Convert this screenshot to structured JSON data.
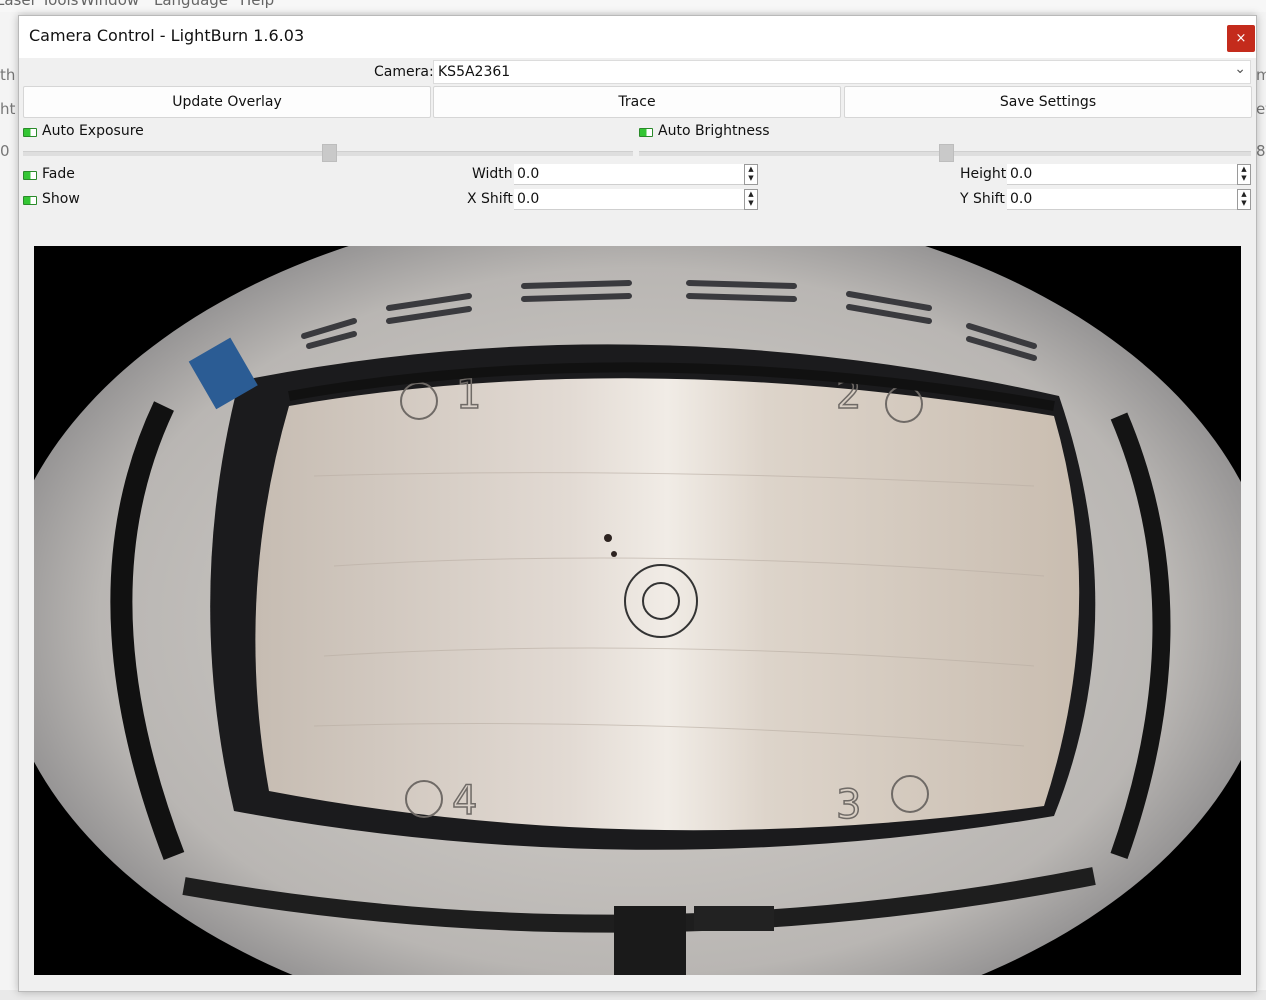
{
  "background": {
    "menu_items": [
      "Laser Tools",
      "Window",
      "Language",
      "Help"
    ],
    "edge_left": [
      "th",
      "ht",
      "0"
    ],
    "edge_right": [
      "m",
      "et",
      "8"
    ]
  },
  "dialog": {
    "title": "Camera Control - LightBurn 1.6.03",
    "close_glyph": "×"
  },
  "camera": {
    "label": "Camera:",
    "value": "KS5A2361"
  },
  "buttons": {
    "update_overlay": "Update Overlay",
    "trace": "Trace",
    "save_settings": "Save Settings"
  },
  "toggles": {
    "auto_exposure": "Auto Exposure",
    "auto_brightness": "Auto Brightness",
    "fade": "Fade",
    "show": "Show"
  },
  "fields": {
    "width": {
      "label": "Width",
      "value": "0.0"
    },
    "height": {
      "label": "Height",
      "value": "0.0"
    },
    "x_shift": {
      "label": "X Shift",
      "value": "0.0"
    },
    "y_shift": {
      "label": "Y Shift",
      "value": "0.0"
    }
  },
  "sliders": {
    "auto_exposure_level": 0.5,
    "auto_brightness_level": 0.5
  },
  "camera_view": {
    "markers": [
      "1",
      "2",
      "3",
      "4"
    ]
  },
  "colors": {
    "close_button": "#c42b1c",
    "led_on": "#34c634"
  }
}
